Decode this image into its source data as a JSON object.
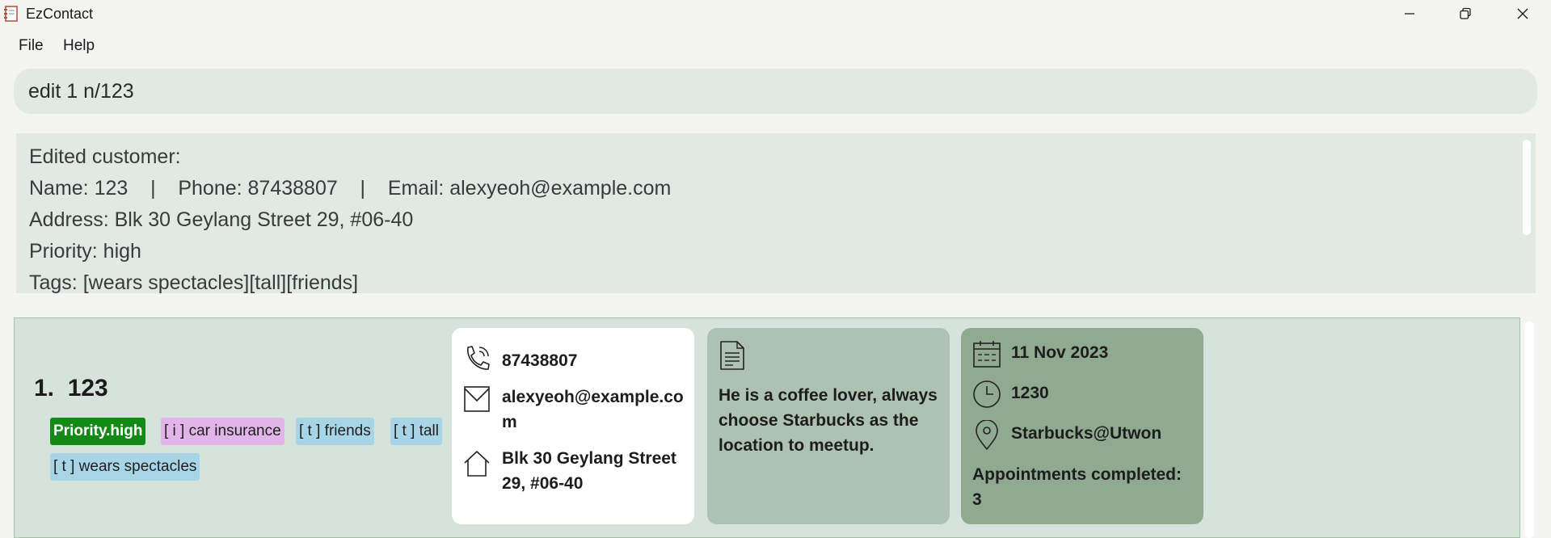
{
  "window": {
    "title": "EzContact"
  },
  "menu": {
    "items": [
      "File",
      "Help"
    ]
  },
  "command": {
    "value": "edit 1 n/123"
  },
  "result": {
    "lines": [
      "Edited customer:",
      "Name: 123    |    Phone: 87438807    |    Email: alexyeoh@example.com",
      "Address: Blk 30 Geylang Street 29, #06-40",
      "Priority: high",
      "Tags: [wears spectacles][tall][friends]"
    ]
  },
  "card": {
    "index_name": "1.  123",
    "tags": [
      {
        "label": "Priority.high",
        "kind": "priority"
      },
      {
        "label": "[ i ] car insurance",
        "kind": "insurance"
      },
      {
        "label": "[ t ] friends",
        "kind": "tag"
      },
      {
        "label": "[ t ] tall",
        "kind": "tag"
      },
      {
        "label": "[ t ] wears spectacles",
        "kind": "tag"
      }
    ],
    "contact": {
      "phone": "87438807",
      "email_line1": "alexyeoh@example.co",
      "email_line2": "m",
      "address_line1": "Blk 30 Geylang Street",
      "address_line2": "29, #06-40"
    },
    "note": {
      "text": "He is a coffee lover, always choose Starbucks as the location to meetup."
    },
    "appointment": {
      "date": "11 Nov 2023",
      "time": "1230",
      "location": "Starbucks@Utwon",
      "completed_label": "Appointments completed:",
      "completed_count": "3"
    }
  },
  "icons": {
    "app": "address-book-icon",
    "minimize": "minimize-icon",
    "maximize": "restore-icon",
    "close": "close-icon",
    "phone": "phone-icon",
    "email": "envelope-icon",
    "address": "house-icon",
    "note": "document-icon",
    "date": "calendar-icon",
    "time": "clock-icon",
    "location": "location-pin-icon"
  },
  "colors": {
    "priority_high": "#138a16",
    "insurance_tag": "#e1b5e8",
    "generic_tag": "#a8d5e6",
    "note_panel": "#aec2b3",
    "appointment_panel": "#8faa91"
  }
}
